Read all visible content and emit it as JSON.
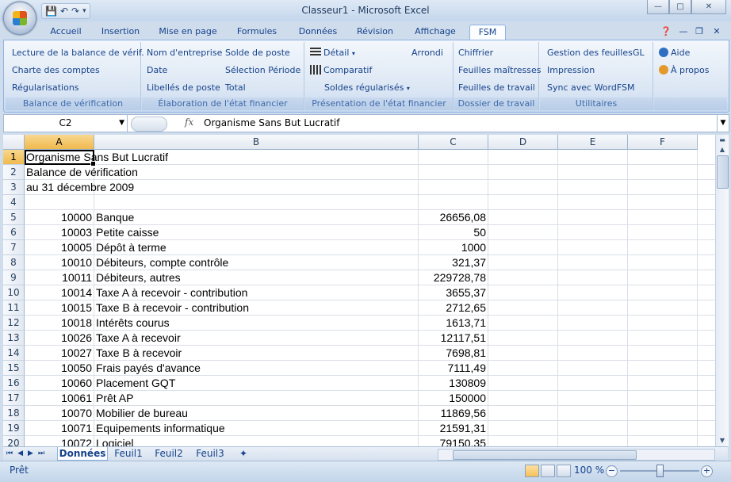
{
  "window": {
    "title": "Classeur1 - Microsoft Excel"
  },
  "qat": {
    "save_icon": "save-icon",
    "undo_icon": "undo-icon",
    "redo_icon": "redo-icon"
  },
  "tabs": [
    "Accueil",
    "Insertion",
    "Mise en page",
    "Formules",
    "Données",
    "Révision",
    "Affichage",
    "FSM"
  ],
  "ribbon": {
    "balance": {
      "caption": "Balance de vérification",
      "items": [
        "Lecture de la balance de vérif.",
        "Charte des comptes",
        "Régularisations"
      ]
    },
    "elaboration": {
      "caption": "Élaboration de l'état financier",
      "col1": [
        "Nom d'entreprise",
        "Date",
        "Libellés de poste"
      ],
      "col2": [
        "Solde de poste",
        "Sélection Période",
        "Total"
      ]
    },
    "presentation": {
      "caption": "Présentation de l'état financier",
      "detail": "Détail",
      "arrondi": "Arrondi",
      "comparatif": "Comparatif",
      "soldes": "Soldes régularisés"
    },
    "dossier": {
      "caption": "Dossier de travail",
      "items": [
        "Chiffrier",
        "Feuilles maîtresses",
        "Feuilles de travail"
      ]
    },
    "utilitaires": {
      "caption": "Utilitaires",
      "items": [
        "Gestion des feuilles",
        "Impression",
        "Sync avec WordFSM"
      ],
      "gl": "GL"
    },
    "aide": {
      "items": [
        "Aide",
        "À propos"
      ]
    }
  },
  "formula": {
    "namebox": "C2",
    "fx": "fx",
    "content": "Organisme Sans But Lucratif"
  },
  "columns": [
    "A",
    "B",
    "C",
    "D",
    "E",
    "F"
  ],
  "rows": [
    {
      "num": "1",
      "a": "Organisme Sans But Lucratif",
      "b": "",
      "c": ""
    },
    {
      "num": "2",
      "a": "Balance de vérification",
      "b": "",
      "c": ""
    },
    {
      "num": "3",
      "a": "au 31 décembre 2009",
      "b": "",
      "c": ""
    },
    {
      "num": "4",
      "a": "",
      "b": "",
      "c": ""
    },
    {
      "num": "5",
      "a": "10000",
      "b": "Banque",
      "c": "26656,08"
    },
    {
      "num": "6",
      "a": "10003",
      "b": "Petite caisse",
      "c": "50"
    },
    {
      "num": "7",
      "a": "10005",
      "b": "Dépôt à terme",
      "c": "1000"
    },
    {
      "num": "8",
      "a": "10010",
      "b": "Débiteurs, compte contrôle",
      "c": "321,37"
    },
    {
      "num": "9",
      "a": "10011",
      "b": "Débiteurs, autres",
      "c": "229728,78"
    },
    {
      "num": "10",
      "a": "10014",
      "b": "Taxe A à recevoir - contribution",
      "c": "3655,37"
    },
    {
      "num": "11",
      "a": "10015",
      "b": "Taxe B à recevoir - contribution",
      "c": "2712,65"
    },
    {
      "num": "12",
      "a": "10018",
      "b": "Intérêts courus",
      "c": "1613,71"
    },
    {
      "num": "13",
      "a": "10026",
      "b": "Taxe A à recevoir",
      "c": "12117,51"
    },
    {
      "num": "14",
      "a": "10027",
      "b": "Taxe B à recevoir",
      "c": "7698,81"
    },
    {
      "num": "15",
      "a": "10050",
      "b": "Frais payés d'avance",
      "c": "7111,49"
    },
    {
      "num": "16",
      "a": "10060",
      "b": "Placement GQT",
      "c": "130809"
    },
    {
      "num": "17",
      "a": "10061",
      "b": "Prêt AP",
      "c": "150000"
    },
    {
      "num": "18",
      "a": "10070",
      "b": "Mobilier de bureau",
      "c": "11869,56"
    },
    {
      "num": "19",
      "a": "10071",
      "b": "Equipements informatique",
      "c": "21591,31"
    },
    {
      "num": "20",
      "a": "10072",
      "b": "Logiciel",
      "c": "79150,35"
    }
  ],
  "sheets": [
    "Données",
    "Feuil1",
    "Feuil2",
    "Feuil3"
  ],
  "status": {
    "text": "Prêt",
    "zoom": "100 %"
  }
}
